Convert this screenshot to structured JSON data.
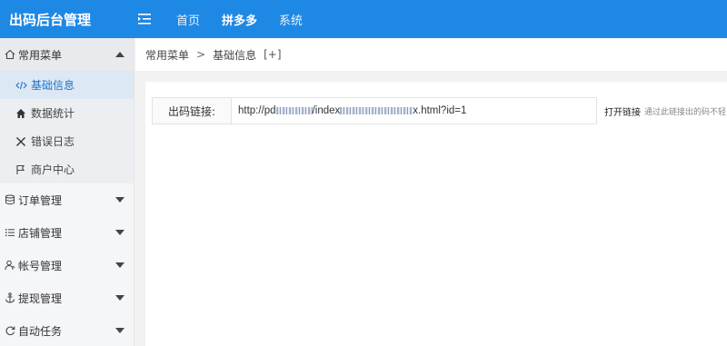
{
  "header": {
    "logo": "出码后台管理",
    "menu_toggle_icon": "menu-fold-icon",
    "nav": [
      "首页",
      "拼多多",
      "系统"
    ],
    "nav_active": "拼多多"
  },
  "sidebar": {
    "groups": [
      {
        "label": "常用菜单",
        "icon": "home-icon",
        "open": true,
        "items": [
          {
            "label": "基础信息",
            "icon": "code-icon",
            "active": true
          },
          {
            "label": "数据统计",
            "icon": "home-solid-icon"
          },
          {
            "label": "错误日志",
            "icon": "close-icon"
          },
          {
            "label": "商户中心",
            "icon": "flag-icon"
          }
        ]
      },
      {
        "label": "订单管理",
        "icon": "database-icon"
      },
      {
        "label": "店铺管理",
        "icon": "list-icon"
      },
      {
        "label": "帐号管理",
        "icon": "user-icon"
      },
      {
        "label": "提现管理",
        "icon": "anchor-icon"
      },
      {
        "label": "自动任务",
        "icon": "refresh-icon"
      }
    ]
  },
  "breadcrumb": {
    "root": "常用菜单",
    "sep": ">",
    "current": "基础信息",
    "add": "[+]"
  },
  "form": {
    "label": "出码链接:",
    "value_prefix": "http://pd",
    "value_mid": "/index",
    "value_suffix": "x.html?id=1",
    "open_link": "打开链接",
    "hint": "通过此链接出的码不轻"
  },
  "colors": {
    "header_bg": "#1e88e5",
    "active_item": "#1e73c8"
  }
}
